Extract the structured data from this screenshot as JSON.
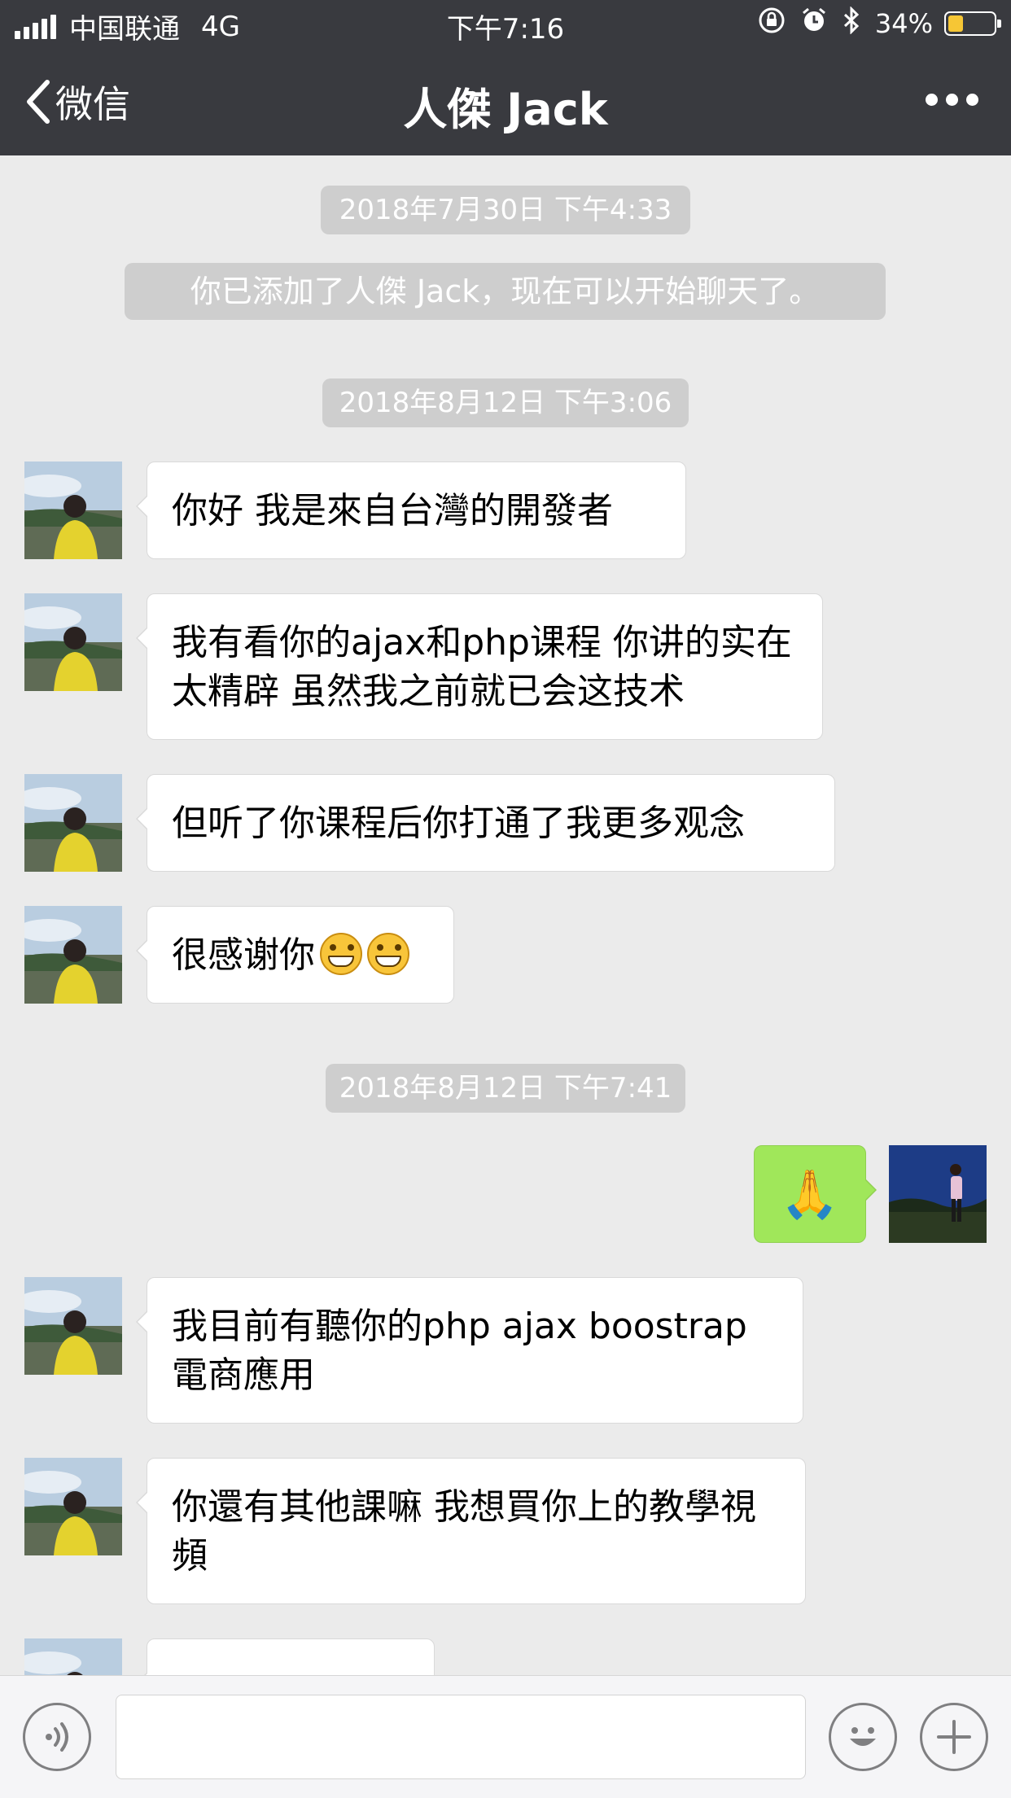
{
  "status_bar": {
    "carrier": "中国联通",
    "network": "4G",
    "time": "下午7:16",
    "battery_percent": "34%",
    "battery_level": 0.34,
    "colors": {
      "battery_fill": "#f6c635"
    }
  },
  "nav": {
    "back_label": "微信",
    "title": "人傑 Jack"
  },
  "chat": {
    "timestamps": [
      "2018年7月30日 下午4:33",
      "2018年8月12日 下午3:06",
      "2018年8月12日 下午7:41"
    ],
    "system_notice": "你已添加了人傑 Jack，现在可以开始聊天了。",
    "messages": [
      {
        "from": "contact",
        "text": "你好 我是來自台灣的開發者"
      },
      {
        "from": "contact",
        "text": "我有看你的ajax和php课程 你讲的实在太精辟 虽然我之前就已会这技术"
      },
      {
        "from": "contact",
        "text": "但听了你课程后你打通了我更多观念"
      },
      {
        "from": "contact",
        "text": "很感谢你",
        "emoji": [
          "grin-icon",
          "grin-icon"
        ]
      },
      {
        "from": "me",
        "text": "🙏"
      },
      {
        "from": "contact",
        "text": "我目前有聽你的php ajax boostrap電商應用"
      },
      {
        "from": "contact",
        "text": "你還有其他課嘛 我想買你上的教學視頻"
      }
    ]
  },
  "input_bar": {
    "voice_icon": "voice-icon",
    "emoji_icon": "smiley-icon",
    "add_icon": "plus-icon"
  },
  "colors": {
    "nav_background": "#393a3f",
    "chat_background": "#ebebeb",
    "my_bubble": "#a0e75a",
    "contact_bubble": "#ffffff",
    "timestamp_pill": "#cecece"
  }
}
